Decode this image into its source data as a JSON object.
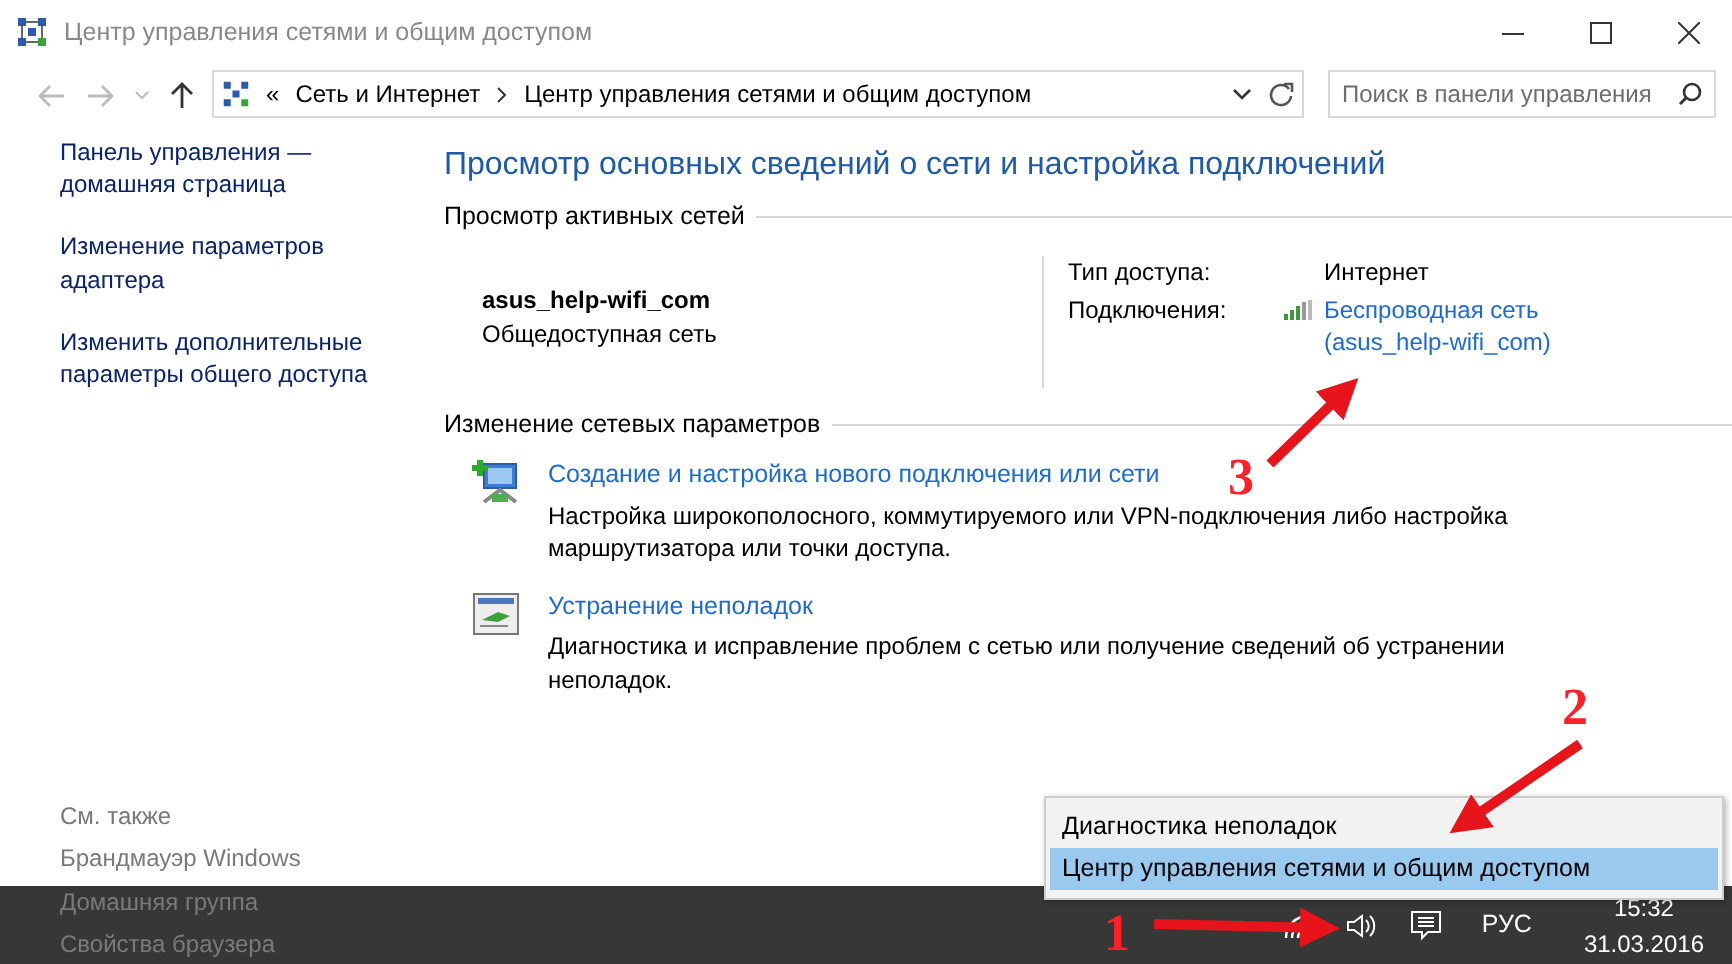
{
  "window": {
    "title": "Центр управления сетями и общим доступом"
  },
  "address_bar": {
    "overflow": "«",
    "breadcrumbs": [
      "Сеть и Интернет",
      "Центр управления сетями и общим доступом"
    ]
  },
  "search": {
    "placeholder": "Поиск в панели управления"
  },
  "sidebar": {
    "links": [
      "Панель управления — домашняя страница",
      "Изменение параметров адаптера",
      "Изменить дополнительные параметры общего доступа"
    ],
    "see_also": {
      "title": "См. также",
      "links": [
        "Брандмауэр Windows",
        "Домашняя группа",
        "Свойства браузера"
      ]
    }
  },
  "main": {
    "title": "Просмотр основных сведений о сети и настройка подключений",
    "active_networks": {
      "heading": "Просмотр активных сетей",
      "network_name": "asus_help-wifi_com",
      "network_category": "Общедоступная сеть",
      "access_type": {
        "label": "Тип доступа:",
        "value": "Интернет"
      },
      "connections": {
        "label": "Подключения:",
        "link_lines": [
          "Беспроводная сеть",
          "(asus_help-wifi_com)"
        ]
      }
    },
    "change_settings": {
      "heading": "Изменение сетевых параметров",
      "tasks": [
        {
          "kind": "setup",
          "link": "Создание и настройка нового подключения или сети",
          "description": "Настройка широкополосного, коммутируемого или VPN-подключения либо настройка маршрутизатора или точки доступа."
        },
        {
          "kind": "troubleshoot",
          "link": "Устранение неполадок",
          "description": "Диагностика и исправление проблем с сетью или получение сведений об устранении неполадок."
        }
      ]
    }
  },
  "context_menu": {
    "items": [
      {
        "label": "Диагностика неполадок",
        "selected": false
      },
      {
        "label": "Центр управления сетями и общим доступом",
        "selected": true
      }
    ]
  },
  "taskbar": {
    "language": "РУС",
    "time": "15:32",
    "date": "31.03.2016"
  },
  "annotations": [
    {
      "number": "1"
    },
    {
      "number": "2"
    },
    {
      "number": "3"
    }
  ]
}
